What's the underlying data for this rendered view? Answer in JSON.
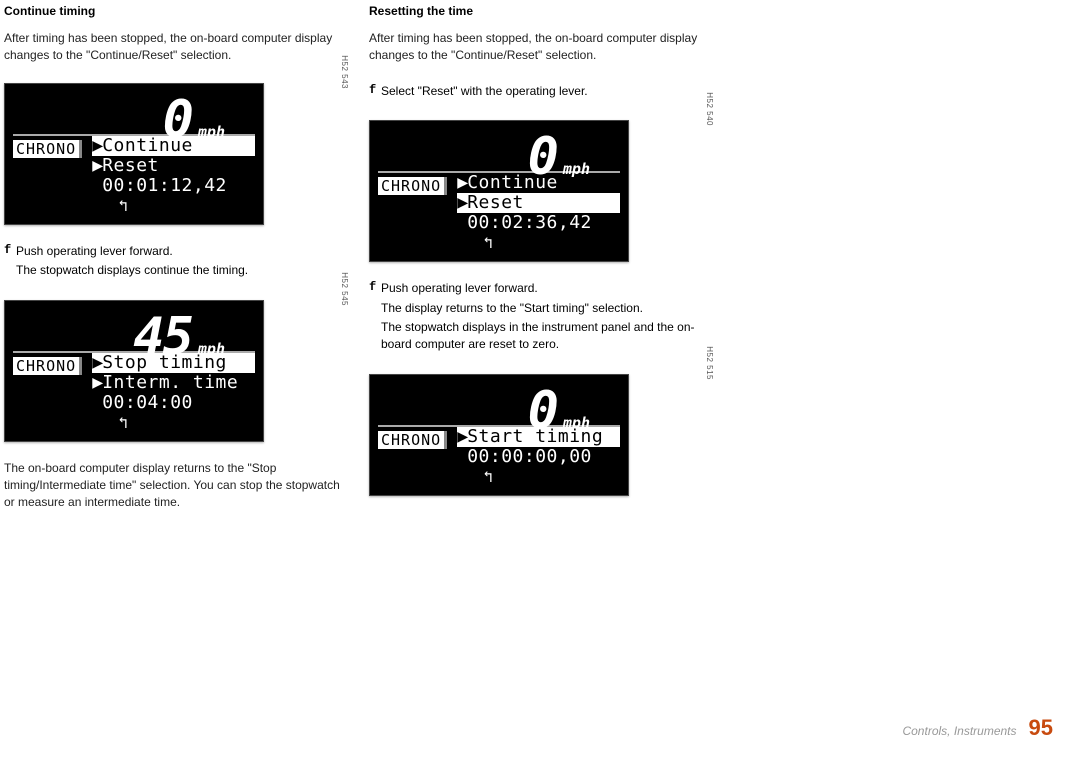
{
  "col1": {
    "heading": "Continue timing",
    "para1": "After timing has been stopped, the on-board computer display changes to the \"Continue/Reset\" selection.",
    "screen1": {
      "speed": "0",
      "unit": "mph",
      "label": "CHRONO",
      "row1": "Continue",
      "row2": "Reset",
      "time": "00:01:12,42",
      "code": "H52 543"
    },
    "step1_mark": "f",
    "step1_line1": "Push operating lever forward.",
    "step1_line2": "The stopwatch displays continue the timing.",
    "screen2": {
      "speed": "45",
      "unit": "mph",
      "label": "CHRONO",
      "row1": "Stop timing",
      "row2": "Interm. time",
      "time": "00:04:00",
      "code": "H52 545"
    },
    "para2": "The on-board computer display returns to the \"Stop timing/Intermediate time\" selection. You can stop the stopwatch or measure an intermediate time."
  },
  "col2": {
    "heading": "Resetting the time",
    "para1": "After timing has been stopped, the on-board computer display changes to the \"Continue/Reset\" selection.",
    "step1_mark": "f",
    "step1_line1": "Select \"Reset\" with the operating lever.",
    "screen1": {
      "speed": "0",
      "unit": "mph",
      "label": "CHRONO",
      "row1": "Continue",
      "row2": "Reset",
      "time": "00:02:36,42",
      "code": "H52 540"
    },
    "step2_mark": "f",
    "step2_line1": "Push operating lever forward.",
    "step2_line2": "The display returns to the \"Start timing\" selection.",
    "step2_line3": "The stopwatch displays in the instrument panel and the on-board computer are reset to zero.",
    "screen2": {
      "speed": "0",
      "unit": "mph",
      "label": "CHRONO",
      "row1": "Start timing",
      "time": "00:00:00,00",
      "code": "H52 515"
    }
  },
  "footer": {
    "text": "Controls, Instruments",
    "page": "95"
  },
  "glyphs": {
    "tri": "▶",
    "back": "↰"
  }
}
